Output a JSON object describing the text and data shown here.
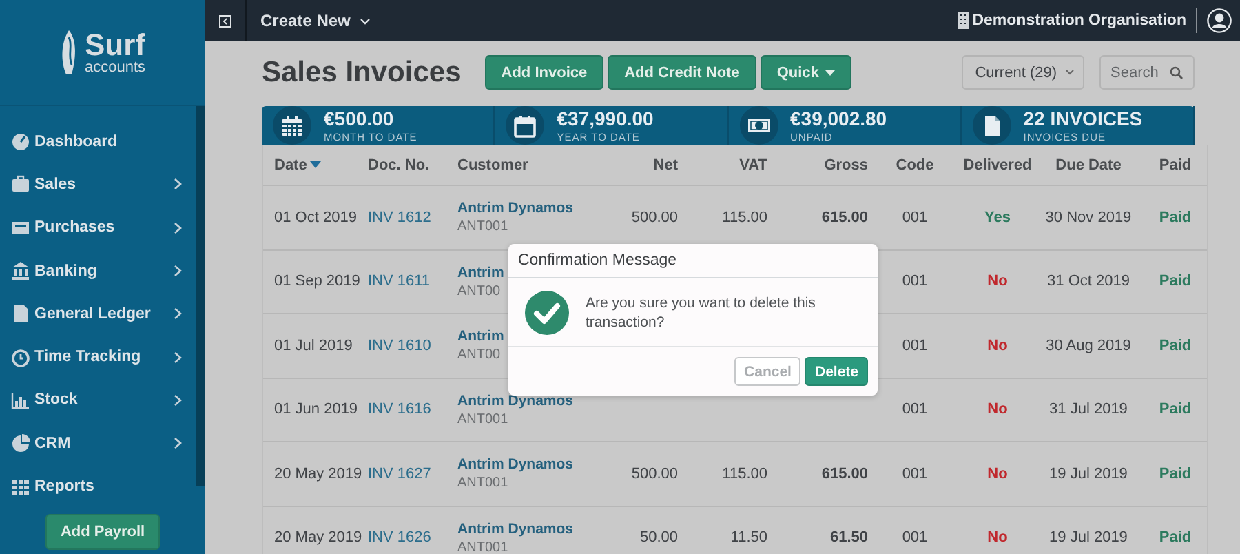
{
  "sidebar": {
    "logo": {
      "name": "Surf",
      "tagline": "accounts"
    },
    "items": [
      {
        "label": "Dashboard",
        "has_submenu": false
      },
      {
        "label": "Sales",
        "has_submenu": true
      },
      {
        "label": "Purchases",
        "has_submenu": true
      },
      {
        "label": "Banking",
        "has_submenu": true
      },
      {
        "label": "General Ledger",
        "has_submenu": true
      },
      {
        "label": "Time Tracking",
        "has_submenu": true
      },
      {
        "label": "Stock",
        "has_submenu": true
      },
      {
        "label": "CRM",
        "has_submenu": true
      },
      {
        "label": "Reports",
        "has_submenu": false
      }
    ],
    "button": "Add Payroll"
  },
  "topbar": {
    "menu": "Create New",
    "organisation": "Demonstration Organisation"
  },
  "page": {
    "title": "Sales Invoices",
    "buttons": [
      {
        "label": "Add Invoice",
        "dropdown": false
      },
      {
        "label": "Add Credit Note",
        "dropdown": false
      },
      {
        "label": "Quick",
        "dropdown": true
      }
    ],
    "filter": "Current (29)",
    "search": {
      "placeholder": "Search"
    }
  },
  "stats": [
    {
      "value": "€500.00",
      "label": "MONTH TO DATE"
    },
    {
      "value": "€37,990.00",
      "label": "YEAR TO DATE"
    },
    {
      "value": "€39,002.80",
      "label": "UNPAID"
    },
    {
      "value": "22 INVOICES",
      "label": "INVOICES DUE"
    }
  ],
  "table": {
    "columns": [
      {
        "label": "Date",
        "sorted": true
      },
      {
        "label": "Doc. No.",
        "sorted": false
      },
      {
        "label": "Customer",
        "sorted": false
      },
      {
        "label": "Net",
        "sorted": false
      },
      {
        "label": "VAT",
        "sorted": false
      },
      {
        "label": "Gross",
        "sorted": false
      },
      {
        "label": "Code",
        "sorted": false
      },
      {
        "label": "Delivered",
        "sorted": false
      },
      {
        "label": "Due Date",
        "sorted": false
      },
      {
        "label": "Paid",
        "sorted": false
      }
    ],
    "rows": [
      {
        "date": "01 Oct 2019",
        "doc": "INV 1612",
        "customer": "Antrim Dynamos",
        "account": "ANT001",
        "net": "500.00",
        "vat": "115.00",
        "gross": "615.00",
        "code": "001",
        "delivered": "Yes",
        "delivered_ok": true,
        "due": "30 Nov 2019",
        "paid": "Paid"
      },
      {
        "date": "01 Sep 2019",
        "doc": "INV 1611",
        "customer": "Antrim",
        "account": "ANT00",
        "code": "001",
        "delivered": "No",
        "delivered_ok": false,
        "due": "31 Oct 2019",
        "paid": "Paid"
      },
      {
        "date": "01 Jul 2019",
        "doc": "INV 1610",
        "customer": "Antrim",
        "account": "ANT00",
        "code": "001",
        "delivered": "No",
        "delivered_ok": false,
        "due": "30 Aug 2019",
        "paid": "Paid"
      },
      {
        "date": "01 Jun 2019",
        "doc": "INV 1616",
        "customer": "Antrim Dynamos",
        "account": "ANT001",
        "code": "001",
        "delivered": "No",
        "delivered_ok": false,
        "due": "31 Jul 2019",
        "paid": "Paid"
      },
      {
        "date": "20 May 2019",
        "doc": "INV 1627",
        "customer": "Antrim Dynamos",
        "account": "ANT001",
        "net": "500.00",
        "vat": "115.00",
        "gross": "615.00",
        "code": "001",
        "delivered": "No",
        "delivered_ok": false,
        "due": "19 Jul 2019",
        "paid": "Paid"
      },
      {
        "date": "20 May 2019",
        "doc": "INV 1626",
        "customer": "Antrim Dynamos",
        "account": "ANT001",
        "net": "50.00",
        "vat": "11.50",
        "gross": "61.50",
        "code": "001",
        "delivered": "No",
        "delivered_ok": false,
        "due": "19 Jul 2019",
        "paid": "Paid"
      }
    ]
  },
  "dialog": {
    "title": "Confirmation Message",
    "message": "Are you sure you want to delete this transaction?",
    "buttons": [
      {
        "label": "Cancel",
        "kind": "secondary"
      },
      {
        "label": "Delete",
        "kind": "primary"
      }
    ]
  }
}
